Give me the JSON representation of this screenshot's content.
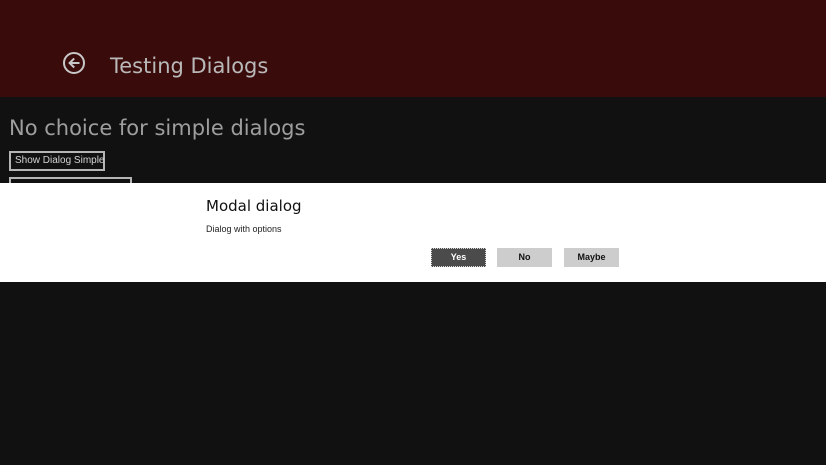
{
  "header": {
    "title": "Testing Dialogs",
    "back_icon": "back-arrow-circle-icon",
    "background": "#3a0b0b"
  },
  "main": {
    "heading": "No choice for simple dialogs",
    "buttons": [
      {
        "label": "Show Dialog Simple"
      }
    ]
  },
  "dialog": {
    "title": "Modal dialog",
    "message": "Dialog with options",
    "buttons": [
      {
        "label": "Yes"
      },
      {
        "label": "No"
      },
      {
        "label": "Maybe"
      }
    ]
  },
  "colors": {
    "page_background": "#111111",
    "dialog_background": "#ffffff",
    "default_button": "#4b4b4b",
    "secondary_button": "#cdcdcd"
  }
}
